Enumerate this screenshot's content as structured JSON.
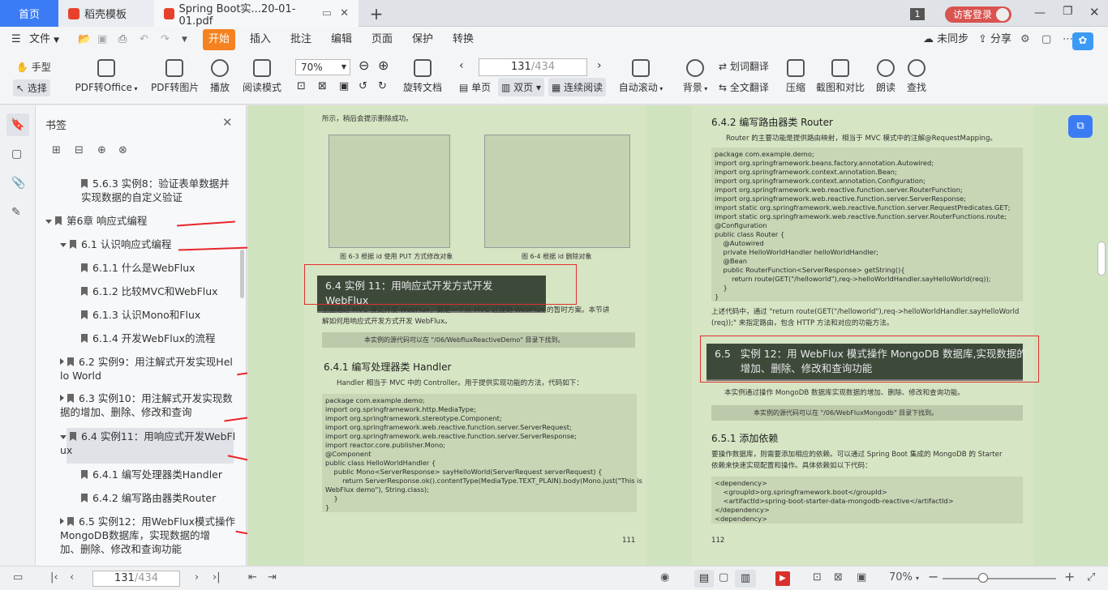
{
  "tabs": {
    "home": "首页",
    "template": "稻壳模板",
    "document": "Spring Boot实...20-01-01.pdf",
    "new_tab": "+"
  },
  "titlebar": {
    "badge": "1",
    "login": "访客登录"
  },
  "menu": {
    "file": "文件",
    "items": [
      "开始",
      "插入",
      "批注",
      "编辑",
      "页面",
      "保护",
      "转换"
    ],
    "sync": "未同步",
    "share": "分享"
  },
  "ribbon": {
    "hand": "手型",
    "select": "选择",
    "pdf_office": "PDF转Office",
    "pdf_image": "PDF转图片",
    "play": "播放",
    "read_mode": "阅读模式",
    "zoom": "70%",
    "rotate": "旋转文档",
    "page_current": "131",
    "page_total": "/434",
    "single": "单页",
    "double": "双页",
    "continuous": "连续阅读",
    "auto_scroll": "自动滚动",
    "background": "背景",
    "word_translate": "划词翻译",
    "full_translate": "全文翻译",
    "compress": "压缩",
    "screenshot": "截图和对比",
    "read_aloud": "朗读",
    "find": "查找"
  },
  "bookmarks": {
    "title": "书签",
    "items": [
      {
        "label": "5.6.3 实例8：验证表单数据并\n实现数据的自定义验证"
      },
      {
        "label": "第6章 响应式编程"
      },
      {
        "label": "6.1 认识响应式编程"
      },
      {
        "label": "6.1.1 什么是WebFlux"
      },
      {
        "label": "6.1.2 比较MVC和WebFlux"
      },
      {
        "label": "6.1.3 认识Mono和Flux"
      },
      {
        "label": "6.1.4 开发WebFlux的流程"
      },
      {
        "label": "6.2 实例9：用注解式开发实现Hel\nlo World"
      },
      {
        "label": "6.3 实例10：用注解式开发实现数\n据的增加、删除、修改和查询"
      },
      {
        "label": "6.4 实例11：用响应式开发WebFl\nux"
      },
      {
        "label": "6.4.1 编写处理器类Handler"
      },
      {
        "label": "6.4.2 编写路由器类Router"
      },
      {
        "label": "6.5 实例12：用WebFlux模式操作\nMongoDB数据库，实现数据的增\n加、删除、修改和查询功能"
      }
    ]
  },
  "left_page": {
    "top_text": "所示，稍后会提示删除成功。",
    "fig3_caption": "图 6-3   根据 id 使用 PUT 方式修改对象",
    "fig4_caption": "图 6-4   根据 id 删除对象",
    "section": "6.4   实例 11：用响应式开发方式开发 WebFlux",
    "para1": "上面通过 MVC 模式开发 WebFlux，算是一个从 MVC 过渡到 WebFlux 的暂时方案。本节讲\n解如何用响应式开发方式开发 WebFlux。",
    "note": "本实例的源代码可以在 \"/06/WebfluxReactiveDemo\" 目录下找到。",
    "h641": "6.4.1   编写处理器类 Handler",
    "para2": "Handler 相当于 MVC 中的 Controller。用于提供实现功能的方法，代码如下：",
    "code": "package com.example.demo;\nimport org.springframework.http.MediaType;\nimport org.springframework.stereotype.Component;\nimport org.springframework.web.reactive.function.server.ServerRequest;\nimport org.springframework.web.reactive.function.server.ServerResponse;\nimport reactor.core.publisher.Mono;\n@Component\npublic class HelloWorldHandler {\n    public Mono<ServerResponse> sayHelloWorld(ServerRequest serverRequest) {\n        return ServerResponse.ok().contentType(MediaType.TEXT_PLAIN).body(Mono.just(\"This is\nWebFlux demo\"), String.class);\n    }\n}",
    "page_no": "111"
  },
  "right_page": {
    "h642": "6.4.2   编写路由器类 Router",
    "para1": "Router 的主要功能是提供路由映射，相当于 MVC 模式中的注解@RequestMapping。",
    "code": "package com.example.demo;\nimport org.springframework.beans.factory.annotation.Autowired;\nimport org.springframework.context.annotation.Bean;\nimport org.springframework.context.annotation.Configuration;\nimport org.springframework.web.reactive.function.server.RouterFunction;\nimport org.springframework.web.reactive.function.server.ServerResponse;\nimport static org.springframework.web.reactive.function.server.RequestPredicates.GET;\nimport static org.springframework.web.reactive.function.server.RouterFunctions.route;\n@Configuration\npublic class Router {\n    @Autowired\n    private HelloWorldHandler helloWorldHandler;\n    @Bean\n    public RouterFunction<ServerResponse> getString(){\n        return route(GET(\"/helloworld\"),req->helloWorldHandler.sayHelloWorld(req));\n    }\n}",
    "para2": "上述代码中，通过 \"return route(GET(\"/helloworld\"),req->helloWorldHandler.sayHelloWorld\n(req));\" 来指定路由，包含 HTTP 方法和对应的功能方法。",
    "section": "6.5   实例 12：用 WebFlux 模式操作 MongoDB 数据库,实现数据的\n        增加、删除、修改和查询功能",
    "para3": "本实例通过操作 MongoDB 数据库实现数据的增加、删除、修改和查询功能。",
    "note": "本实例的源代码可以在 \"/06/WebFluxMongodb\" 目录下找到。",
    "h651": "6.5.1   添加依赖",
    "para4": "要操作数据库，则需要添加相应的依赖。可以通过 Spring Boot 集成的 MongoDB 的 Starter\n依赖来快速实现配置和操作。具体依赖如以下代码：",
    "code2": "<dependency>\n    <groupId>org.springframework.boot</groupId>\n    <artifactId>spring-boot-starter-data-mongodb-reactive</artifactId>\n</dependency>\n<dependency>",
    "page_no": "112"
  },
  "status": {
    "page_current": "131",
    "page_total": "/434",
    "zoom": "70%"
  },
  "colors": {
    "accent": "#3b7cf5",
    "start_tab": "#f58220",
    "arrow": "#e8262b",
    "page_bg": "#d6e5c3"
  }
}
